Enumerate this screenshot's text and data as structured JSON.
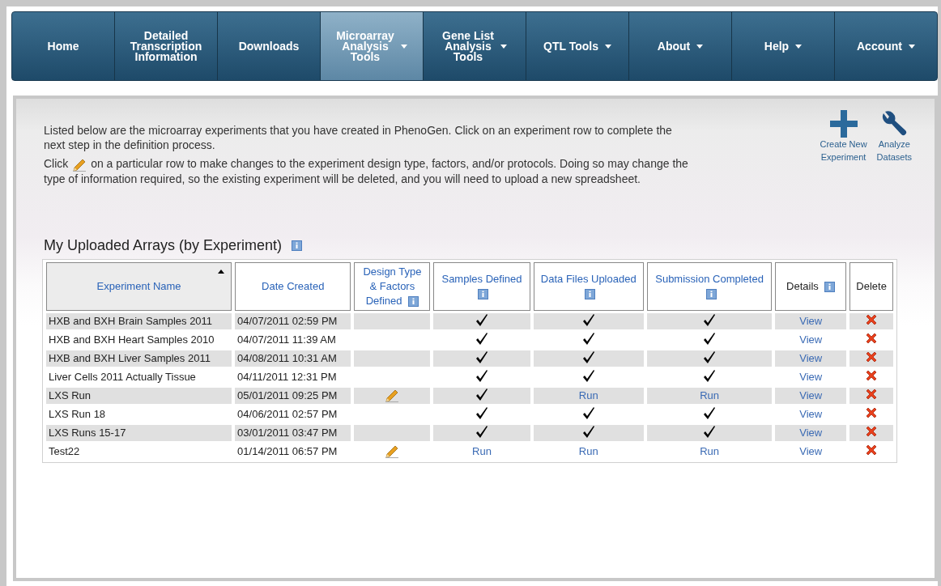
{
  "nav": [
    {
      "lines": [
        "Home"
      ],
      "selected": false,
      "menu": false
    },
    {
      "lines": [
        "Detailed",
        "Transcription",
        "Information"
      ],
      "selected": false,
      "menu": false
    },
    {
      "lines": [
        "Downloads"
      ],
      "selected": false,
      "menu": false
    },
    {
      "lines": [
        "Microarray",
        "Analysis",
        "Tools"
      ],
      "selected": true,
      "menu": true
    },
    {
      "lines": [
        "Gene List",
        "Analysis",
        "Tools"
      ],
      "selected": false,
      "menu": true
    },
    {
      "lines": [
        "QTL Tools"
      ],
      "selected": false,
      "menu": true
    },
    {
      "lines": [
        "About"
      ],
      "selected": false,
      "menu": true
    },
    {
      "lines": [
        "Help"
      ],
      "selected": false,
      "menu": true
    },
    {
      "lines": [
        "Account"
      ],
      "selected": false,
      "menu": true
    }
  ],
  "intro": {
    "paragraph_1": "Listed below are the microarray experiments that you have created in PhenoGen. Click on an experiment row to complete the next step in the definition process.",
    "paragraph_2_before_icon": "Click",
    "paragraph_2_after_icon": "on a particular row to make changes to the experiment design type, factors, and/or protocols. Doing so may change the type of information required, so the existing experiment will be deleted, and you will need to upload a new spreadsheet."
  },
  "actions": [
    {
      "kind": "plus",
      "lines": [
        "Create New",
        "Experiment"
      ]
    },
    {
      "kind": "wrench",
      "lines": [
        "Analyze",
        "Datasets"
      ]
    }
  ],
  "section_title": "My Uploaded Arrays (by Experiment)",
  "table": {
    "columns": [
      {
        "label": "Experiment Name",
        "link": true,
        "info": false,
        "sorted": true
      },
      {
        "label": "Date Created",
        "link": true,
        "info": false,
        "sorted": false
      },
      {
        "label": "Design Type & Factors Defined",
        "link": true,
        "info": true,
        "sorted": false
      },
      {
        "label": "Samples Defined",
        "link": true,
        "info": true,
        "sorted": false
      },
      {
        "label": "Data Files Uploaded",
        "link": true,
        "info": true,
        "sorted": false
      },
      {
        "label": "Submission Completed",
        "link": true,
        "info": true,
        "sorted": false
      },
      {
        "label": "Details",
        "link": false,
        "info": true,
        "sorted": false
      },
      {
        "label": "Delete",
        "link": false,
        "info": false,
        "sorted": false
      }
    ],
    "rows": [
      {
        "name": "HXB and BXH Brain Samples 2011",
        "date": "04/07/2011 02:59 PM",
        "design": {
          "kind": "empty"
        },
        "samples": {
          "kind": "check"
        },
        "files": {
          "kind": "check"
        },
        "submission": {
          "kind": "check"
        },
        "details": "View"
      },
      {
        "name": "HXB and BXH Heart Samples 2010",
        "date": "04/07/2011 11:39 AM",
        "design": {
          "kind": "empty"
        },
        "samples": {
          "kind": "check"
        },
        "files": {
          "kind": "check"
        },
        "submission": {
          "kind": "check"
        },
        "details": "View"
      },
      {
        "name": "HXB and BXH Liver Samples 2011",
        "date": "04/08/2011 10:31 AM",
        "design": {
          "kind": "empty"
        },
        "samples": {
          "kind": "check"
        },
        "files": {
          "kind": "check"
        },
        "submission": {
          "kind": "check"
        },
        "details": "View"
      },
      {
        "name": "Liver Cells 2011 Actually Tissue",
        "date": "04/11/2011 12:31 PM",
        "design": {
          "kind": "empty"
        },
        "samples": {
          "kind": "check"
        },
        "files": {
          "kind": "check"
        },
        "submission": {
          "kind": "check"
        },
        "details": "View"
      },
      {
        "name": "LXS Run",
        "date": "05/01/2011 09:25 PM",
        "design": {
          "kind": "pencil"
        },
        "samples": {
          "kind": "check"
        },
        "files": {
          "kind": "link",
          "text": "Run"
        },
        "submission": {
          "kind": "link",
          "text": "Run"
        },
        "details": "View"
      },
      {
        "name": "LXS Run 18",
        "date": "04/06/2011 02:57 PM",
        "design": {
          "kind": "empty"
        },
        "samples": {
          "kind": "check"
        },
        "files": {
          "kind": "check"
        },
        "submission": {
          "kind": "check"
        },
        "details": "View"
      },
      {
        "name": "LXS Runs 15-17",
        "date": "03/01/2011 03:47 PM",
        "design": {
          "kind": "empty"
        },
        "samples": {
          "kind": "check"
        },
        "files": {
          "kind": "check"
        },
        "submission": {
          "kind": "check"
        },
        "details": "View"
      },
      {
        "name": "Test22",
        "date": "01/14/2011 06:57 PM",
        "design": {
          "kind": "pencil"
        },
        "samples": {
          "kind": "link",
          "text": "Run"
        },
        "files": {
          "kind": "link",
          "text": "Run"
        },
        "submission": {
          "kind": "link",
          "text": "Run"
        },
        "details": "View"
      }
    ]
  }
}
